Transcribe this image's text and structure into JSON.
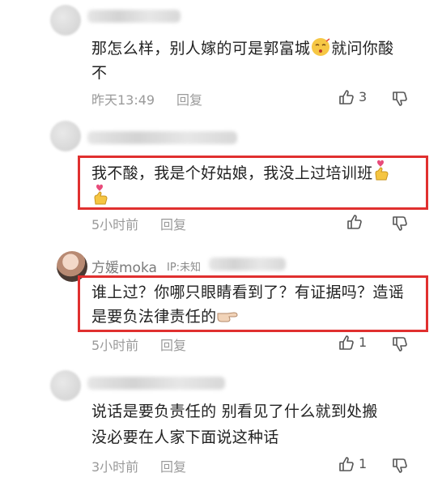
{
  "comments": [
    {
      "line1": "那怎么样，别人嫁的可是郭富城",
      "line1_tail": "就问你酸",
      "line2": "不",
      "time": "昨天13:49",
      "reply": "回复",
      "likes": "3",
      "emoji": "face-emoji"
    },
    {
      "line1": "我不酸，我是个好姑娘，我没上过培训班",
      "time": "5小时前",
      "reply": "回复",
      "likes": "",
      "emoji": "hand-heart-emoji"
    },
    {
      "user": "方媛moka",
      "ip": "IP:未知",
      "line1": "谁上过？你哪只眼睛看到了？有证据吗？造谣",
      "line2": "是要负法律责任的",
      "time": "5小时前",
      "reply": "回复",
      "likes": "1",
      "emoji": "pointing-hand-emoji"
    },
    {
      "line1": "说话是要负责任的 别看见了什么就到处搬",
      "line2": "没必要在人家下面说这种话",
      "time": "3小时前",
      "reply": "回复",
      "likes": "1"
    }
  ],
  "colors": {
    "highlight_border": "#e0302f",
    "meta": "#9a9a9a"
  }
}
